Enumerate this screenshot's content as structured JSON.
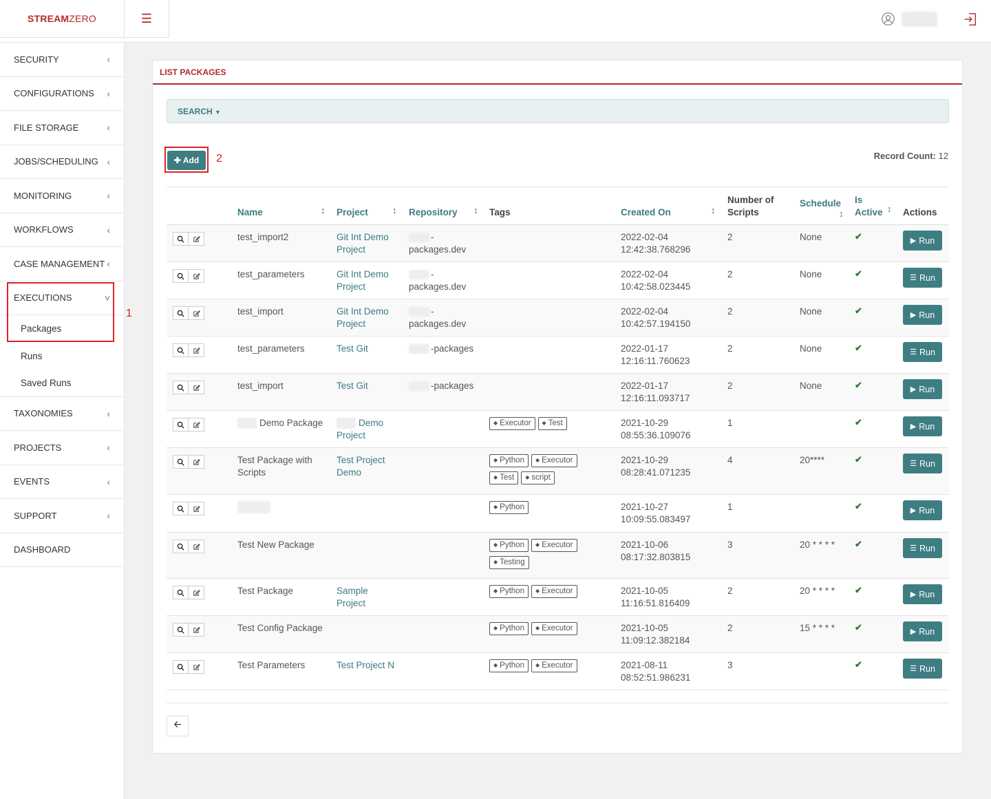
{
  "brand": {
    "part1": "STREAM",
    "part2": "ZERO"
  },
  "colors": {
    "brand": "#b02a2a",
    "accent": "#3e7e83",
    "highlight": "#d9222a",
    "active_check": "#2e7d32"
  },
  "icons": {
    "menu": "hamburger-icon",
    "user": "user-circle-icon",
    "logout": "sign-out-icon"
  },
  "sidebar": {
    "items": [
      {
        "label": "SECURITY",
        "name": "security"
      },
      {
        "label": "CONFIGURATIONS",
        "name": "configurations"
      },
      {
        "label": "FILE STORAGE",
        "name": "file-storage"
      },
      {
        "label": "JOBS/SCHEDULING",
        "name": "jobs-scheduling"
      },
      {
        "label": "MONITORING",
        "name": "monitoring"
      },
      {
        "label": "WORKFLOWS",
        "name": "workflows"
      },
      {
        "label": "CASE MANAGEMENT",
        "name": "case-management"
      },
      {
        "label": "EXECUTIONS",
        "name": "executions",
        "expanded": true,
        "sub": [
          "Packages",
          "Runs",
          "Saved Runs"
        ]
      },
      {
        "label": "TAXONOMIES",
        "name": "taxonomies"
      },
      {
        "label": "PROJECTS",
        "name": "projects"
      },
      {
        "label": "EVENTS",
        "name": "events"
      },
      {
        "label": "SUPPORT",
        "name": "support"
      },
      {
        "label": "DASHBOARD",
        "name": "dashboard",
        "no_chevron": true
      }
    ]
  },
  "annotations": {
    "one": "1",
    "two": "2"
  },
  "panel": {
    "title": "LIST PACKAGES",
    "search_label": "SEARCH",
    "add_label": "Add",
    "record_count_label": "Record Count:",
    "record_count": "12"
  },
  "table": {
    "headers": {
      "name": "Name",
      "project": "Project",
      "repository": "Repository",
      "tags": "Tags",
      "created_on": "Created On",
      "num_scripts_1": "Number of",
      "num_scripts_2": "Scripts",
      "schedule": "Schedule",
      "is_active_1": "Is",
      "is_active_2": "Active",
      "actions": "Actions"
    },
    "rows": [
      {
        "name": "test_import2",
        "project": [
          "Git Int Demo",
          "Project"
        ],
        "repo": [
          "-",
          "packages.dev"
        ],
        "repo_blur": true,
        "tags": [
          []
        ],
        "created": [
          "2022-02-04",
          "12:42:38.768296"
        ],
        "scripts": "2",
        "schedule": "None",
        "run": "Run",
        "run_icon": "play"
      },
      {
        "name": "test_parameters",
        "project": [
          "Git Int Demo",
          "Project"
        ],
        "repo": [
          "-",
          "packages.dev"
        ],
        "repo_blur": true,
        "tags": [
          []
        ],
        "created": [
          "2022-02-04",
          "10:42:58.023445"
        ],
        "scripts": "2",
        "schedule": "None",
        "run": "Run",
        "run_icon": "list"
      },
      {
        "name": "test_import",
        "project": [
          "Git Int Demo",
          "Project"
        ],
        "repo": [
          "-",
          "packages.dev"
        ],
        "repo_blur": true,
        "tags": [
          []
        ],
        "created": [
          "2022-02-04",
          "10:42:57.194150"
        ],
        "scripts": "2",
        "schedule": "None",
        "run": "Run",
        "run_icon": "play"
      },
      {
        "name": "test_parameters",
        "project": [
          "Test Git"
        ],
        "repo": [
          "-packages"
        ],
        "repo_blur": true,
        "tags": [
          []
        ],
        "created": [
          "2022-01-17",
          "12:16:11.760623"
        ],
        "scripts": "2",
        "schedule": "None",
        "run": "Run",
        "run_icon": "list"
      },
      {
        "name": "test_import",
        "project": [
          "Test Git"
        ],
        "repo": [
          "-packages"
        ],
        "repo_blur": true,
        "tags": [
          []
        ],
        "created": [
          "2022-01-17",
          "12:16:11.093717"
        ],
        "scripts": "2",
        "schedule": "None",
        "run": "Run",
        "run_icon": "play"
      },
      {
        "name": "Demo Package",
        "name_blur": true,
        "project": [
          "Demo",
          "Project"
        ],
        "project_blur": true,
        "repo": [],
        "tags": [
          [
            "Executor",
            "Test"
          ]
        ],
        "created": [
          "2021-10-29",
          "08:55:36.109076"
        ],
        "scripts": "1",
        "schedule": "",
        "run": "Run",
        "run_icon": "play"
      },
      {
        "name": "Test Package with Scripts",
        "project": [
          "Test Project",
          "Demo"
        ],
        "repo": [],
        "tags": [
          [
            "Python",
            "Executor"
          ],
          [
            "Test",
            "script"
          ]
        ],
        "created": [
          "2021-10-29",
          "08:28:41.071235"
        ],
        "scripts": "4",
        "schedule": "20****",
        "run": "Run",
        "run_icon": "list"
      },
      {
        "name": "",
        "name_blur_only": true,
        "project": [],
        "repo": [],
        "tags": [
          [
            "Python"
          ]
        ],
        "created": [
          "2021-10-27",
          "10:09:55.083497"
        ],
        "scripts": "1",
        "schedule": "",
        "run": "Run",
        "run_icon": "play"
      },
      {
        "name": "Test New Package",
        "project": [],
        "repo": [],
        "tags": [
          [
            "Python",
            "Executor"
          ],
          [
            "Testing"
          ]
        ],
        "created": [
          "2021-10-06",
          "08:17:32.803815"
        ],
        "scripts": "3",
        "schedule": "20 * * * *",
        "run": "Run",
        "run_icon": "list"
      },
      {
        "name": "Test Package",
        "project": [
          "Sample",
          "Project"
        ],
        "repo": [],
        "tags": [
          [
            "Python",
            "Executor"
          ]
        ],
        "created": [
          "2021-10-05",
          "11:16:51.816409"
        ],
        "scripts": "2",
        "schedule": "20 * * * *",
        "run": "Run",
        "run_icon": "play"
      },
      {
        "name": "Test Config Package",
        "project": [],
        "repo": [],
        "tags": [
          [
            "Python",
            "Executor"
          ]
        ],
        "created": [
          "2021-10-05",
          "11:09:12.382184"
        ],
        "scripts": "2",
        "schedule": "15 * * * *",
        "run": "Run",
        "run_icon": "play"
      },
      {
        "name": "Test Parameters",
        "project": [
          "Test Project N"
        ],
        "repo": [],
        "tags": [
          [
            "Python",
            "Executor"
          ]
        ],
        "created": [
          "2021-08-11",
          "08:52:51.986231"
        ],
        "scripts": "3",
        "schedule": "",
        "run": "Run",
        "run_icon": "list"
      }
    ]
  }
}
